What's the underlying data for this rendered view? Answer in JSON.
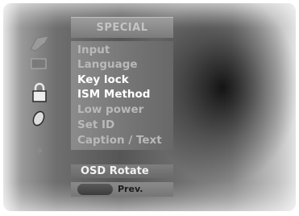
{
  "menu": {
    "title": "SPECIAL",
    "items": [
      {
        "label": "Input",
        "state": "dim"
      },
      {
        "label": "Language",
        "state": "dim"
      },
      {
        "label": "Key lock",
        "state": "bright"
      },
      {
        "label": "ISM Method",
        "state": "bright"
      },
      {
        "label": "Low power",
        "state": "dim"
      },
      {
        "label": "Set ID",
        "state": "dim"
      },
      {
        "label": "Caption / Text",
        "state": "dim"
      }
    ]
  },
  "side_icons": [
    "special-icon",
    "screen-icon",
    "lock-icon",
    "time-icon",
    "extra-icon"
  ],
  "osd_rotate": {
    "label": "OSD Rotate"
  },
  "prev": {
    "label": "Prev."
  },
  "colors": {
    "highlight_text": "#ffffff",
    "dim_text": "#b9b9b9",
    "panel": "#7a7a7a"
  }
}
